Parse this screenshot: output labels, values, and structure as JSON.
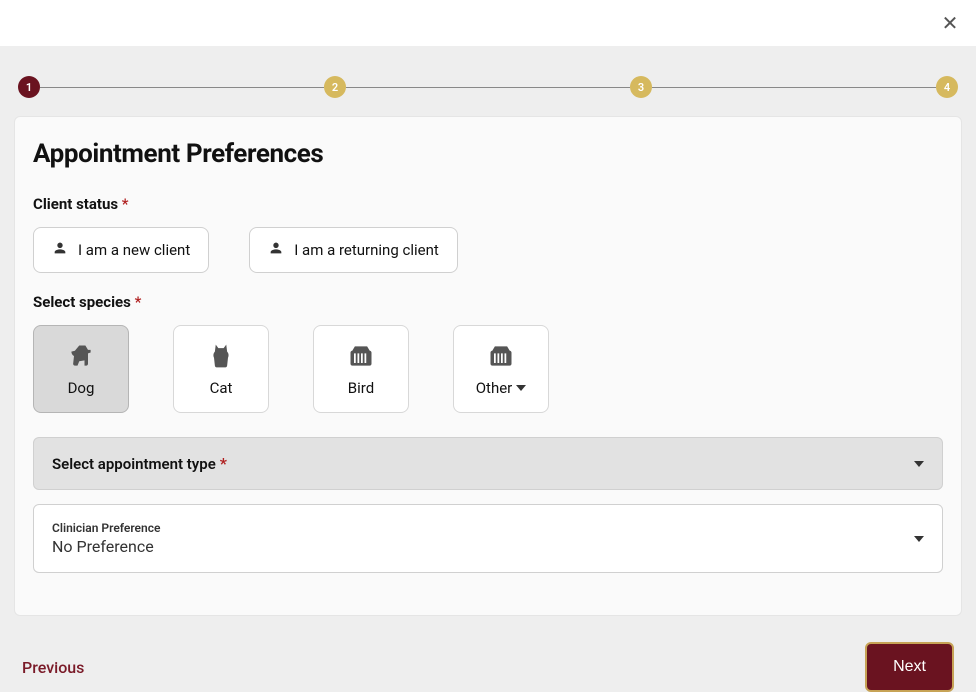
{
  "close_label": "✕",
  "stepper": {
    "steps": [
      "1",
      "2",
      "3",
      "4"
    ],
    "active_index": 0
  },
  "title": "Appointment Preferences",
  "client_status": {
    "label": "Client status",
    "options": {
      "new": "I am a new client",
      "returning": "I am a returning client"
    }
  },
  "species": {
    "label": "Select species",
    "options": {
      "dog": "Dog",
      "cat": "Cat",
      "bird": "Bird",
      "other": "Other"
    },
    "selected": "dog"
  },
  "appointment_type": {
    "placeholder": "Select appointment type"
  },
  "clinician": {
    "label": "Clinician Preference",
    "value": "No Preference"
  },
  "footer": {
    "previous": "Previous",
    "next": "Next"
  },
  "required_marker": "*"
}
